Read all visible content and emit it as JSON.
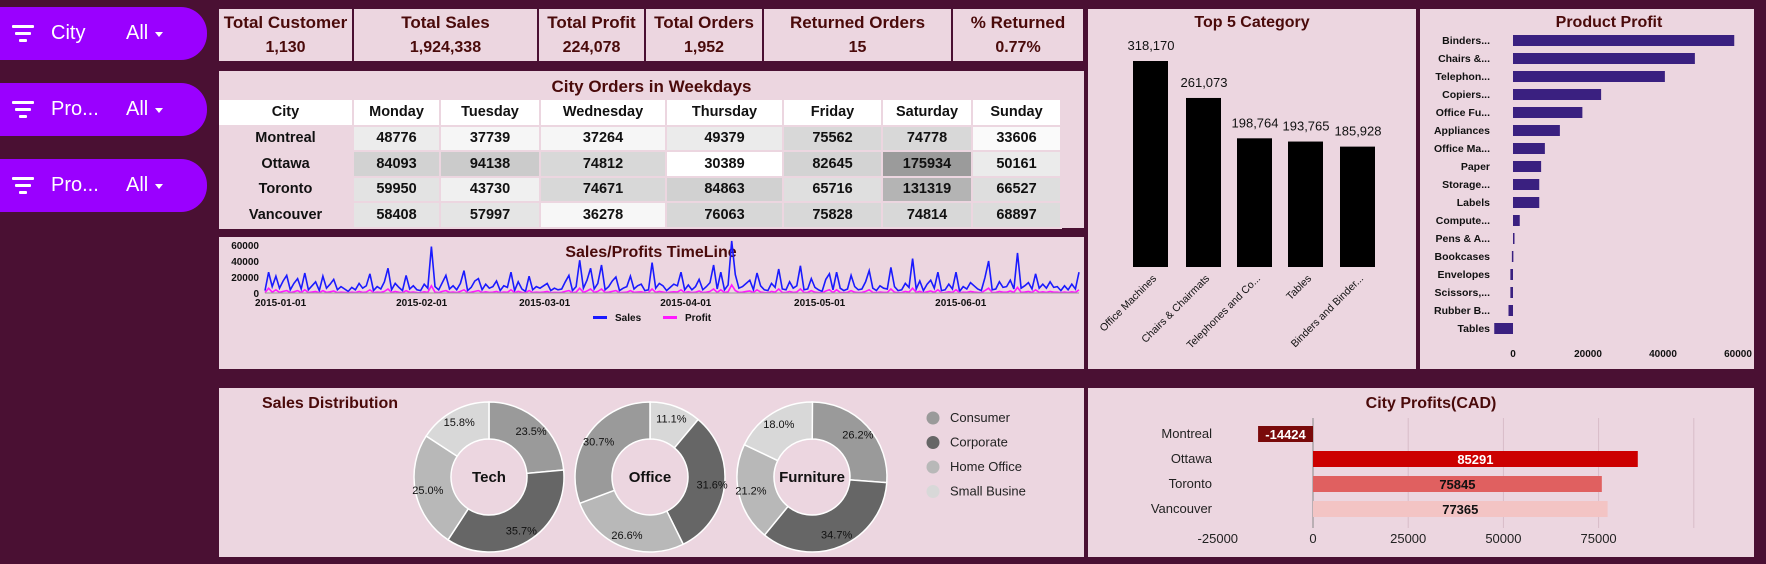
{
  "filters": [
    {
      "label": "City",
      "value": "All"
    },
    {
      "label": "Pro...",
      "value": "All"
    },
    {
      "label": "Pro...",
      "value": "All"
    }
  ],
  "kpis": [
    {
      "title": "Total Customer",
      "value": "1,130"
    },
    {
      "title": "Total Sales",
      "value": "1,924,338"
    },
    {
      "title": "Total Profit",
      "value": "224,078"
    },
    {
      "title": "Total Orders",
      "value": "1,952"
    },
    {
      "title": "Returned Orders",
      "value": "15"
    },
    {
      "title": "% Returned",
      "value": "0.77%"
    }
  ],
  "heatmap": {
    "title": "City Orders in Weekdays",
    "headers": [
      "City",
      "Monday",
      "Tuesday",
      "Wednesday",
      "Thursday",
      "Friday",
      "Saturday",
      "Sunday"
    ],
    "rows": [
      {
        "city": "Montreal",
        "values": [
          48776,
          37739,
          37264,
          49379,
          75562,
          74778,
          33606
        ]
      },
      {
        "city": "Ottawa",
        "values": [
          84093,
          94138,
          74812,
          30389,
          82645,
          175934,
          50161
        ]
      },
      {
        "city": "Toronto",
        "values": [
          59950,
          43730,
          74671,
          84863,
          65716,
          131319,
          66527
        ]
      },
      {
        "city": "Vancouver",
        "values": [
          58408,
          57997,
          36278,
          76063,
          75828,
          74814,
          68897
        ]
      }
    ]
  },
  "chart_data": [
    {
      "type": "line",
      "title": "Sales/Profits TimeLine",
      "x_ticks": [
        "2015-01-01",
        "2015-02-01",
        "2015-03-01",
        "2015-04-01",
        "2015-05-01",
        "2015-06-01"
      ],
      "y_ticks": [
        "60000",
        "40000",
        "20000",
        "0"
      ],
      "ylim": [
        0,
        70000
      ],
      "series": [
        {
          "name": "Sales",
          "color": "#1a1aff",
          "values": [
            3000,
            26000,
            8000,
            21000,
            6000,
            15000,
            22000,
            4000,
            12000,
            18000,
            5000,
            25000,
            4000,
            9000,
            14000,
            3000,
            21000,
            6000,
            11000,
            17000,
            4000,
            8000,
            5000,
            2000,
            7000,
            4000,
            12000,
            6000,
            9000,
            24000,
            3000,
            8000,
            5000,
            14000,
            31000,
            4000,
            12000,
            7000,
            3000,
            22000,
            5000,
            9000,
            4000,
            3000,
            11000,
            6000,
            58000,
            8000,
            4000,
            13000,
            22000,
            5000,
            9000,
            4000,
            12000,
            28000,
            3000,
            7000,
            15000,
            18000,
            4000,
            11000,
            6000,
            8000,
            15000,
            3000,
            9000,
            7000,
            26000,
            3000,
            14000,
            5000,
            2000,
            21000,
            4000,
            8000,
            6000,
            9000,
            12000,
            3000,
            6000,
            4000,
            5000,
            14000,
            22000,
            3000,
            8000,
            41000,
            6000,
            16000,
            31000,
            5000,
            12000,
            35000,
            4000,
            8000,
            15000,
            20000,
            3000,
            6000,
            8000,
            21000,
            5000,
            9000,
            11000,
            3000,
            4000,
            38000,
            6000,
            12000,
            9000,
            3000,
            7000,
            11000,
            9000,
            26000,
            4000,
            10000,
            4000,
            8000,
            17000,
            4000,
            8000,
            13000,
            35000,
            5000,
            26000,
            4000,
            10000,
            65000,
            23000,
            6000,
            8000,
            12000,
            16000,
            4000,
            25000,
            9000,
            4000,
            3000,
            12000,
            7000,
            30000,
            5000,
            4000,
            14000,
            6000,
            9000,
            34000,
            4000,
            5000,
            18000,
            7000,
            4000,
            2000,
            17000,
            24000,
            4000,
            26000,
            6000,
            3000,
            5000,
            22000,
            8000,
            4000,
            5000,
            14000,
            28000,
            6000,
            3000,
            9000,
            6000,
            5000,
            32000,
            8000,
            3000,
            4000,
            12000,
            7000,
            43000,
            5000,
            15000,
            3000,
            11000,
            16000,
            6000,
            26000,
            3000,
            4000,
            11000,
            5000,
            26000,
            2000,
            8000,
            5000,
            13000,
            9000,
            5000,
            3000,
            19000,
            40000,
            4000,
            5000,
            14000,
            7000,
            8000,
            16000,
            5000,
            50000,
            6000,
            9000,
            13000,
            5000,
            24000,
            6000,
            11000,
            6000,
            14000,
            7000,
            8000,
            3000,
            9000,
            4000,
            11000,
            5000,
            26000
          ]
        },
        {
          "name": "Profit",
          "color": "#ff1aff",
          "values": [
            500,
            6000,
            1000,
            4000,
            800,
            2000,
            3000,
            500,
            1500,
            3000,
            600,
            4000,
            500,
            1200,
            2000,
            400,
            3000,
            800,
            1500,
            2500,
            500,
            1000,
            700,
            300,
            1000,
            500,
            2000,
            800,
            1200,
            4000,
            400,
            1000,
            700,
            2000,
            5000,
            600,
            2000,
            900,
            400,
            3000,
            700,
            1200,
            500,
            400,
            1500,
            800,
            9000,
            1000,
            500,
            2000,
            3000,
            700,
            1200,
            500,
            2000,
            4000,
            400,
            1000,
            2000,
            3000,
            600,
            1500,
            800,
            1000,
            2000,
            400,
            1200,
            900,
            4000,
            400,
            2000,
            700,
            300,
            3000,
            600,
            1000,
            800,
            1200,
            2000,
            400,
            800,
            600,
            700,
            2000,
            3000,
            400,
            1000,
            6000,
            800,
            2500,
            5000,
            700,
            2000,
            5000,
            600,
            1000,
            2000,
            3000,
            400,
            800,
            1000,
            3000,
            700,
            1200,
            1500,
            400,
            600,
            5000,
            800,
            2000,
            1200,
            400,
            1000,
            1500,
            1200,
            4000,
            600,
            1500,
            600,
            1000,
            2500,
            600,
            1000,
            2000,
            5000,
            700,
            4000,
            600,
            1500,
            10000,
            3000,
            800,
            1000,
            2000,
            2500,
            600,
            4000,
            1200,
            600,
            400,
            2000,
            1000,
            5000,
            700,
            600,
            2000,
            800,
            1200,
            5000,
            600,
            700,
            3000,
            1000,
            600,
            300,
            2500,
            4000,
            600,
            4000,
            800,
            400,
            700,
            3000,
            1000,
            600,
            700,
            2000,
            4000,
            800,
            400,
            1200,
            800,
            700,
            5000,
            1000,
            400,
            600,
            2000,
            1000,
            6000,
            700,
            2000,
            400,
            1500,
            2500,
            800,
            4000,
            400,
            600,
            1500,
            700,
            4000,
            300,
            1000,
            700,
            2000,
            1200,
            700,
            400,
            3000,
            6000,
            600,
            700,
            2000,
            1000,
            1000,
            2500,
            700,
            7000,
            800,
            1200,
            2000,
            700,
            4000,
            800,
            1500,
            800,
            2000,
            1000,
            1000,
            400,
            1200,
            600,
            1500,
            700,
            4000
          ]
        }
      ]
    },
    {
      "type": "bar",
      "title": "Top 5 Category",
      "categories": [
        "Office Machines",
        "Chairs & Chairmats",
        "Telephones and Co...",
        "Tables",
        "Binders and Binder..."
      ],
      "values": [
        318170,
        261073,
        198764,
        193765,
        185928
      ],
      "labels": [
        "318,170",
        "261,073",
        "198,764",
        "193,765",
        "185,928"
      ],
      "ylim": [
        0,
        318170
      ],
      "color": "#000000"
    },
    {
      "type": "bar",
      "orientation": "horizontal",
      "title": "Product Profit",
      "categories": [
        "Binders...",
        "Chairs &...",
        "Telephon...",
        "Copiers...",
        "Office Fu...",
        "Appliances",
        "Office Ma...",
        "Paper",
        "Storage...",
        "Labels",
        "Compute...",
        "Pens & A...",
        "Bookcases",
        "Envelopes",
        "Scissors,...",
        "Rubber B...",
        "Tables"
      ],
      "values": [
        59000,
        48500,
        40500,
        23500,
        18500,
        12500,
        8500,
        7500,
        7000,
        7000,
        1800,
        400,
        -300,
        -700,
        -700,
        -1200,
        -5000
      ],
      "x_ticks": [
        "0",
        "20000",
        "40000",
        "60000"
      ],
      "xlim": [
        -5000,
        62000
      ],
      "color": "#3a2080"
    },
    {
      "type": "pie",
      "title": "Sales Distribution",
      "legend": [
        "Consumer",
        "Corporate",
        "Home Office",
        "Small Busine"
      ],
      "legend_colors": [
        "#9a9a9a",
        "#666666",
        "#b8b8b8",
        "#d8d8d8"
      ],
      "donuts": [
        {
          "name": "Tech",
          "slices": [
            {
              "cat": "Consumer",
              "value": 23.5,
              "label": "23.5%"
            },
            {
              "cat": "Corporate",
              "value": 35.7,
              "label": "35.7%"
            },
            {
              "cat": "Home Office",
              "value": 25.0,
              "label": "25.0%"
            },
            {
              "cat": "Small Business",
              "value": 15.8,
              "label": "15.8%"
            }
          ]
        },
        {
          "name": "Office",
          "slices": [
            {
              "cat": "Small Business",
              "value": 11.1,
              "label": "11.1%"
            },
            {
              "cat": "Corporate",
              "value": 31.6,
              "label": "31.6%"
            },
            {
              "cat": "Home Office",
              "value": 26.6,
              "label": "26.6%"
            },
            {
              "cat": "Consumer",
              "value": 30.7,
              "label": "30.7%"
            }
          ]
        },
        {
          "name": "Furniture",
          "slices": [
            {
              "cat": "Consumer",
              "value": 26.2,
              "label": "26.2%"
            },
            {
              "cat": "Corporate",
              "value": 34.7,
              "label": "34.7%"
            },
            {
              "cat": "Home Office",
              "value": 21.2,
              "label": "21.2%"
            },
            {
              "cat": "Small Business",
              "value": 18.0,
              "label": "18.0%"
            }
          ]
        }
      ]
    },
    {
      "type": "bar",
      "orientation": "horizontal",
      "title": "City Profits(CAD)",
      "categories": [
        "Montreal",
        "Ottawa",
        "Toronto",
        "Vancouver"
      ],
      "values": [
        -14424,
        85291,
        75845,
        77365
      ],
      "colors": [
        "#7a0a0a",
        "#cc0000",
        "#e06060",
        "#f3c4c4"
      ],
      "x_ticks": [
        "-25000",
        "0",
        "25000",
        "50000",
        "75000"
      ],
      "xlim": [
        -25000,
        100000
      ]
    }
  ]
}
